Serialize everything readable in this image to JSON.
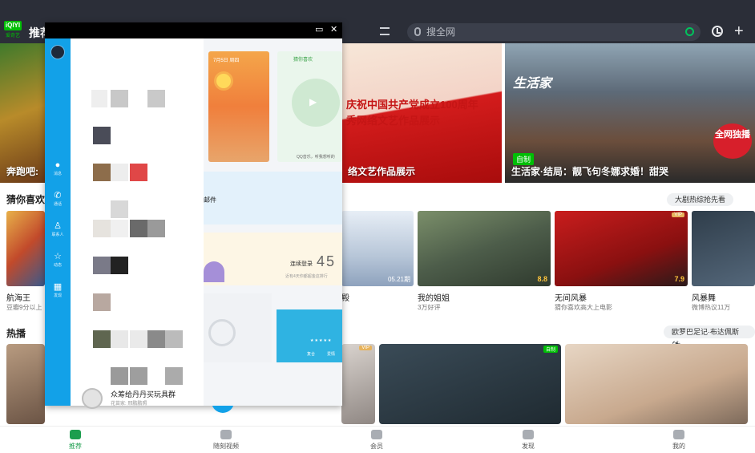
{
  "app": {
    "logo_text": "iQIYI",
    "logo_sub": "爱奇艺",
    "nav_tab": "推荐",
    "search_placeholder": "搜全网"
  },
  "banners": [
    {
      "caption": "奔跑吧:"
    },
    {
      "headline_line1": "庆祝中国共产党成立100周年",
      "headline_line2": "秀网络文艺作品展示",
      "caption": "络文艺作品展示"
    },
    {
      "logo": "生活家",
      "tag": "自制",
      "badge": "全网独播",
      "caption": "生活家·结局：靓飞句冬娜求婚！甜哭"
    }
  ],
  "guess_section": {
    "title": "猜你喜欢",
    "pill": "大剧热综抢先看",
    "cards": [
      {
        "title": "航海王",
        "sub": "豆瓣9分以上"
      },
      {
        "title": "殿",
        "sub": "",
        "ep": "05.21期"
      },
      {
        "title": "我的姐姐",
        "sub": "3万好评",
        "score": "8.8"
      },
      {
        "title": "无间风暴",
        "sub": "猜你喜欢高大上电影",
        "score": "7.9",
        "vip": "VIP"
      },
      {
        "title": "风暴舞",
        "sub": "微博热议11万"
      }
    ]
  },
  "hot_section": {
    "title": "热播",
    "pill": "欧罗巴足记·布达佩斯⚽",
    "vip": "VIP",
    "tag": "自制"
  },
  "bottom_nav": [
    {
      "label": "推荐",
      "active": true
    },
    {
      "label": "随刻视频",
      "active": false
    },
    {
      "label": "会员",
      "active": false
    },
    {
      "label": "发现",
      "active": false
    },
    {
      "label": "我的",
      "active": false
    }
  ],
  "qq_window": {
    "buttons": {
      "restore": "▭",
      "close": "✕"
    },
    "sidebar": [
      {
        "label": "消息",
        "icon": "chat-icon"
      },
      {
        "label": "通话",
        "icon": "phone-icon"
      },
      {
        "label": "联系人",
        "icon": "contacts-icon"
      },
      {
        "label": "动态",
        "icon": "star-icon"
      },
      {
        "label": "发现",
        "icon": "grid-icon"
      }
    ],
    "widgets": {
      "weather_date": "7月5日 周四",
      "music_title": "猜你喜欢",
      "music_sub": "QQ音乐，听我想听的",
      "mail_title": "邮件",
      "sign_label": "连续登录",
      "sign_days": "45",
      "sign_sub": "近有4天你都超金这排行",
      "constel_stars": "★★★★★",
      "constel_btn1": "复合",
      "constel_btn2": "爱情"
    },
    "footer": {
      "name": "众筹给丹丹买玩具群",
      "meta": "花苗家: 邢鹏鹏照"
    },
    "fab": "+"
  }
}
